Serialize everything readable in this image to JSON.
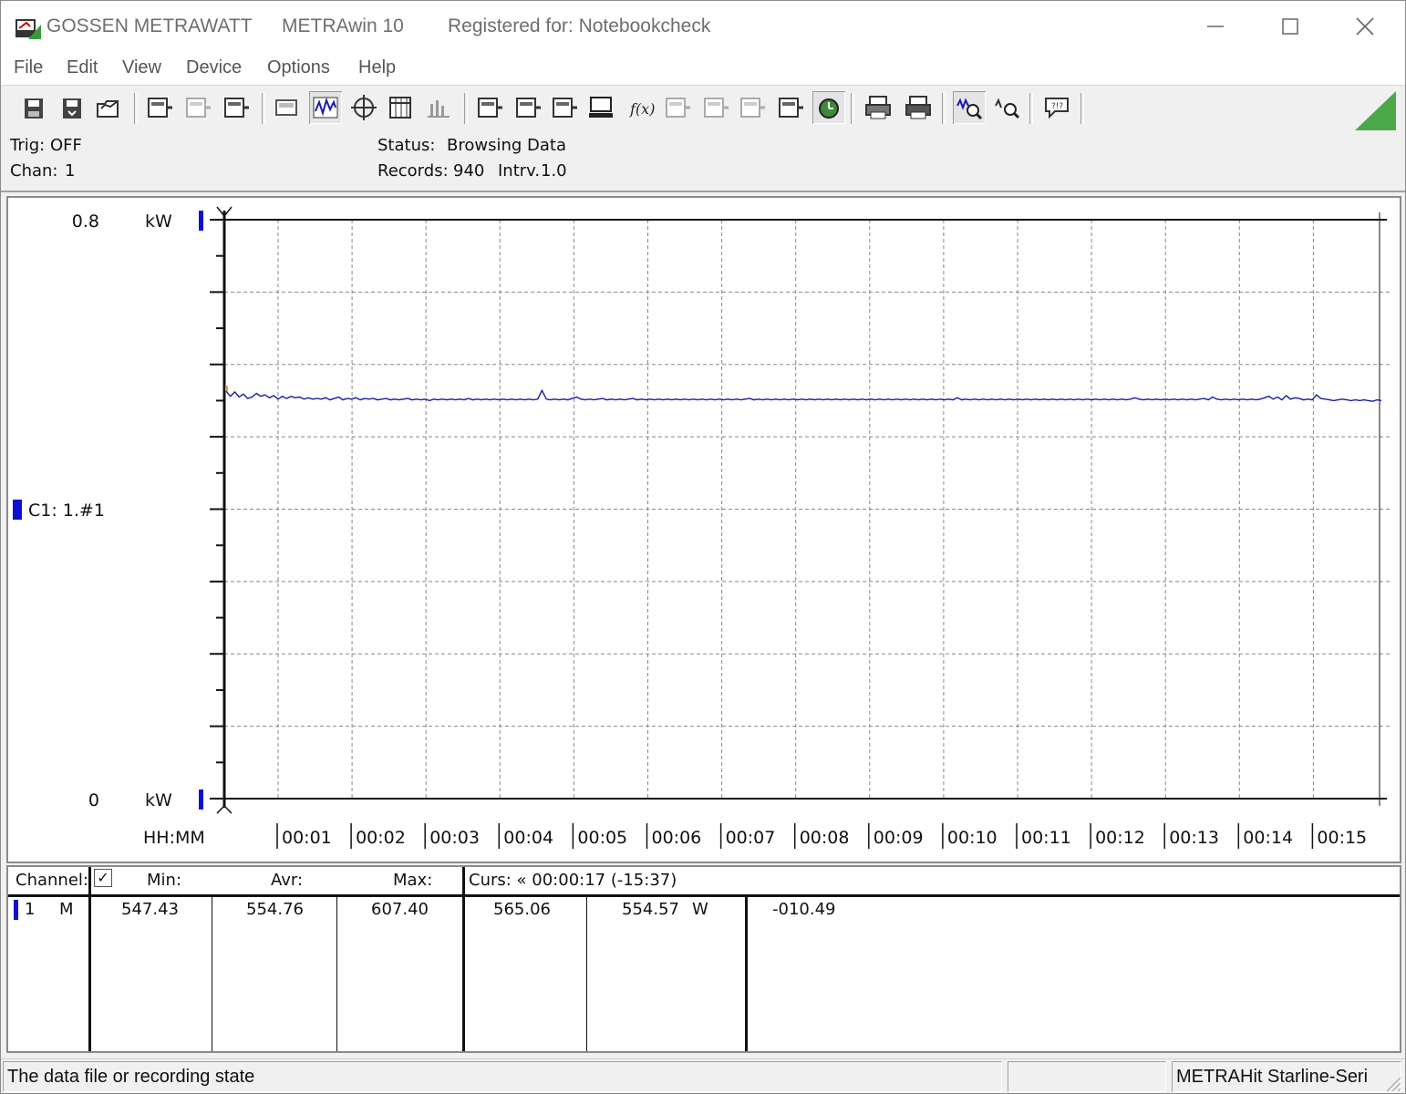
{
  "window": {
    "app_name": "GOSSEN METRAWATT",
    "product": "METRAwin 10",
    "registration": "Registered for: Notebookcheck"
  },
  "menu": [
    "File",
    "Edit",
    "View",
    "Device",
    "Options",
    "Help"
  ],
  "toolbar": {
    "buttons": [
      {
        "name": "save-icon",
        "pressed": false
      },
      {
        "name": "save-as-icon",
        "pressed": false
      },
      {
        "name": "open-folder-icon",
        "pressed": false
      },
      {
        "name": "device-in-icon",
        "pressed": false
      },
      {
        "name": "device-disabled-icon",
        "pressed": false
      },
      {
        "name": "device-out-icon",
        "pressed": false
      },
      {
        "name": "display-icon",
        "pressed": false
      },
      {
        "name": "waveform-view-icon",
        "pressed": true
      },
      {
        "name": "crosshair-icon",
        "pressed": false
      },
      {
        "name": "table-view-icon",
        "pressed": false
      },
      {
        "name": "bar-view-icon",
        "pressed": false
      },
      {
        "name": "channel-settings-icon",
        "pressed": false
      },
      {
        "name": "channel-list-icon",
        "pressed": false
      },
      {
        "name": "record-config-icon",
        "pressed": false
      },
      {
        "name": "computer-icon",
        "pressed": false
      },
      {
        "name": "function-icon",
        "pressed": false
      },
      {
        "name": "monitor-disabled-icon",
        "pressed": false
      },
      {
        "name": "signal-disabled-icon",
        "pressed": false
      },
      {
        "name": "multi-signal-disabled-icon",
        "pressed": false
      },
      {
        "name": "copy-icon",
        "pressed": false
      },
      {
        "name": "trigger-icon",
        "pressed": true
      },
      {
        "name": "print-icon",
        "pressed": false
      },
      {
        "name": "print-preview-icon",
        "pressed": false
      },
      {
        "name": "zoom-waveform-icon",
        "pressed": true
      },
      {
        "name": "zoom-reset-icon",
        "pressed": false
      },
      {
        "name": "help-icon",
        "pressed": false
      }
    ],
    "brand_color": "#4aa84a"
  },
  "status": {
    "trig_label": "Trig:",
    "trig_value": "OFF",
    "chan_label": "Chan:",
    "chan_value": "1",
    "status_label": "Status:",
    "status_value": "Browsing Data",
    "records_label": "Records:",
    "records_value": "940",
    "interval_label": "Intrv.",
    "interval_value": "1.0"
  },
  "chart_data": {
    "type": "line",
    "y_top_label": "0.8",
    "y_bottom_label": "0",
    "y_unit": "kW",
    "ylim": [
      0,
      0.8
    ],
    "x_axis_label": "HH:MM",
    "x_ticks": [
      "00:01",
      "00:02",
      "00:03",
      "00:04",
      "00:05",
      "00:06",
      "00:07",
      "00:08",
      "00:09",
      "00:10",
      "00:11",
      "00:12",
      "00:13",
      "00:14",
      "00:15"
    ],
    "channel_label": "C1: 1.#1",
    "series_color": "#1a1aa0",
    "marker_color": "#1010d0",
    "grid": "dashed",
    "series": [
      {
        "values": [
          0.563,
          0.556,
          0.562,
          0.555,
          0.559,
          0.553,
          0.555,
          0.56,
          0.556,
          0.558,
          0.554,
          0.557,
          0.552,
          0.556,
          0.553,
          0.556,
          0.554,
          0.555,
          0.552,
          0.554,
          0.552,
          0.553,
          0.552,
          0.554,
          0.551,
          0.553,
          0.555,
          0.551,
          0.553,
          0.552,
          0.554,
          0.551,
          0.553,
          0.552,
          0.553,
          0.551,
          0.552,
          0.553,
          0.551,
          0.552,
          0.551,
          0.552,
          0.553,
          0.551,
          0.552,
          0.551,
          0.552,
          0.55,
          0.552,
          0.551,
          0.552,
          0.551,
          0.552,
          0.551,
          0.552,
          0.551,
          0.553,
          0.551,
          0.552,
          0.551,
          0.552,
          0.551,
          0.552,
          0.551,
          0.552,
          0.551,
          0.552,
          0.551,
          0.552,
          0.551,
          0.552,
          0.551,
          0.552,
          0.564,
          0.552,
          0.551,
          0.552,
          0.551,
          0.552,
          0.551,
          0.553,
          0.555,
          0.552,
          0.551,
          0.552,
          0.551,
          0.552,
          0.553,
          0.551,
          0.552,
          0.551,
          0.552,
          0.551,
          0.552,
          0.553,
          0.551,
          0.552,
          0.551,
          0.552,
          0.551,
          0.552,
          0.551,
          0.552,
          0.551,
          0.552,
          0.551,
          0.552,
          0.551,
          0.552,
          0.551,
          0.552,
          0.551,
          0.552,
          0.551,
          0.552,
          0.551,
          0.552,
          0.551,
          0.552,
          0.551,
          0.552,
          0.553,
          0.551,
          0.552,
          0.551,
          0.552,
          0.551,
          0.552,
          0.551,
          0.552,
          0.551,
          0.552,
          0.551,
          0.552,
          0.551,
          0.552,
          0.551,
          0.552,
          0.551,
          0.552,
          0.551,
          0.552,
          0.551,
          0.552,
          0.551,
          0.552,
          0.551,
          0.552,
          0.551,
          0.552,
          0.551,
          0.552,
          0.551,
          0.552,
          0.551,
          0.552,
          0.551,
          0.552,
          0.551,
          0.552,
          0.551,
          0.552,
          0.551,
          0.552,
          0.551,
          0.552,
          0.551,
          0.552,
          0.551,
          0.554,
          0.551,
          0.552,
          0.551,
          0.552,
          0.551,
          0.552,
          0.551,
          0.552,
          0.551,
          0.552,
          0.551,
          0.552,
          0.551,
          0.552,
          0.551,
          0.552,
          0.551,
          0.552,
          0.551,
          0.552,
          0.551,
          0.552,
          0.551,
          0.552,
          0.551,
          0.552,
          0.551,
          0.552,
          0.551,
          0.552,
          0.551,
          0.552,
          0.551,
          0.552,
          0.551,
          0.552,
          0.551,
          0.552,
          0.551,
          0.552,
          0.554,
          0.552,
          0.551,
          0.552,
          0.551,
          0.552,
          0.551,
          0.552,
          0.551,
          0.552,
          0.551,
          0.552,
          0.551,
          0.552,
          0.551,
          0.552,
          0.553,
          0.551,
          0.555,
          0.552,
          0.551,
          0.552,
          0.551,
          0.552,
          0.551,
          0.552,
          0.551,
          0.552,
          0.551,
          0.552,
          0.554,
          0.556,
          0.552,
          0.555,
          0.551,
          0.557,
          0.552,
          0.554,
          0.553,
          0.551,
          0.552,
          0.551,
          0.558,
          0.553,
          0.552,
          0.551,
          0.55,
          0.551,
          0.552,
          0.551,
          0.55,
          0.551,
          0.55,
          0.551,
          0.55,
          0.549,
          0.551,
          0.55
        ]
      }
    ]
  },
  "table": {
    "headers": {
      "channel": "Channel:",
      "checkbox": "✓",
      "min": "Min:",
      "avr": "Avr:",
      "max": "Max:",
      "cursor": "Curs: « 00:00:17 (-15:37)"
    },
    "rows": [
      {
        "channel": "1",
        "mode": "M",
        "min": "547.43",
        "avr": "554.76",
        "max": "607.40",
        "curs1": "565.06",
        "curs2": "554.57",
        "unit": "W",
        "diff": "-010.49"
      }
    ]
  },
  "statusbar": {
    "message": "The data file or recording state",
    "device": "METRAHit Starline-Seri"
  }
}
